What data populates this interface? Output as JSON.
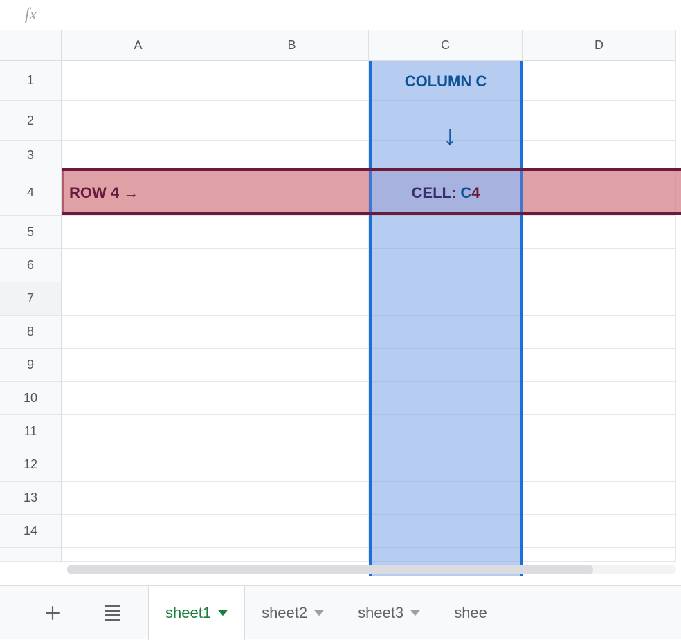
{
  "formula_bar": {
    "fx_label": "fx",
    "value": ""
  },
  "columns": [
    {
      "id": "A",
      "label": "A"
    },
    {
      "id": "B",
      "label": "B"
    },
    {
      "id": "C",
      "label": "C"
    },
    {
      "id": "D",
      "label": "D"
    }
  ],
  "rows": {
    "count": 15,
    "heights": [
      58,
      58,
      42,
      66,
      48,
      48,
      48,
      48,
      48,
      48,
      48,
      48,
      48,
      48,
      20
    ],
    "labels": [
      "1",
      "2",
      "3",
      "4",
      "5",
      "6",
      "7",
      "8",
      "9",
      "10",
      "11",
      "12",
      "13",
      "14",
      ""
    ]
  },
  "annotations": {
    "column_label": "COLUMN C",
    "arrow_down": "↓",
    "row_label": "ROW 4 →",
    "cell_prefix": "CELL:",
    "cell_col": "C",
    "cell_row": "4"
  },
  "sheet_tabs": {
    "active": "sheet1",
    "tabs": [
      {
        "id": "sheet1",
        "label": "sheet1"
      },
      {
        "id": "sheet2",
        "label": "sheet2"
      },
      {
        "id": "sheet3",
        "label": "sheet3"
      },
      {
        "id": "sheet4",
        "label": "shee"
      }
    ]
  },
  "chart_data": {
    "type": "table",
    "title": "Spreadsheet cell reference diagram",
    "columns": [
      "A",
      "B",
      "C",
      "D"
    ],
    "rows": [
      1,
      2,
      3,
      4,
      5,
      6,
      7,
      8,
      9,
      10,
      11,
      12,
      13,
      14
    ],
    "highlighted_column": "C",
    "highlighted_row": 4,
    "intersection_cell": "C4",
    "cell_values": {
      "C1": "COLUMN C",
      "C2": "↓",
      "A4": "ROW 4 →",
      "C4": "CELL: C4"
    }
  }
}
